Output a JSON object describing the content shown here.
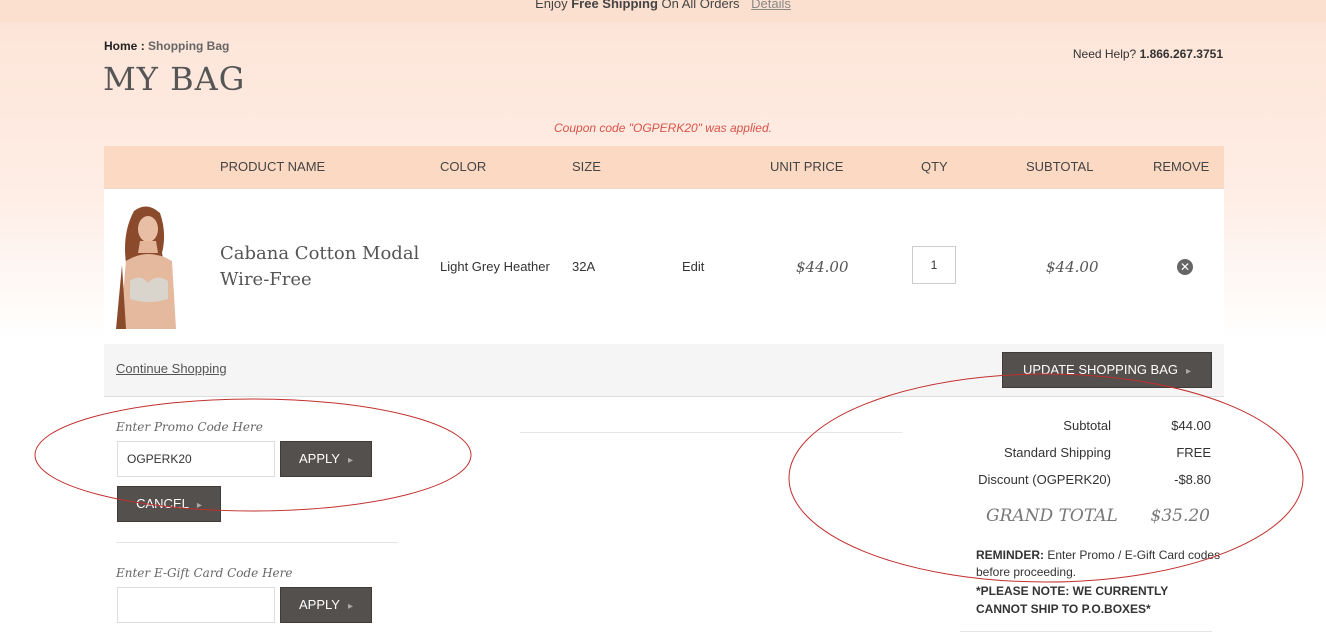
{
  "promo_banner": {
    "prefix": "Enjoy",
    "bold": "Free Shipping",
    "suffix": "On All Orders",
    "details_link": "Details"
  },
  "breadcrumb": {
    "home": "Home",
    "separator": ":",
    "current": "Shopping Bag"
  },
  "page_title": "MY BAG",
  "help": {
    "label": "Need Help?",
    "phone": "1.866.267.3751"
  },
  "coupon_message": "Coupon code \"OGPERK20\" was applied.",
  "table": {
    "headers": [
      "PRODUCT NAME",
      "COLOR",
      "SIZE",
      "UNIT PRICE",
      "QTY",
      "SUBTOTAL",
      "REMOVE"
    ],
    "items": [
      {
        "name": "Cabana Cotton Modal Wire-Free",
        "color": "Light Grey Heather",
        "size": "32A",
        "edit": "Edit",
        "unit_price": "$44.00",
        "qty": "1",
        "subtotal": "$44.00"
      }
    ]
  },
  "actions": {
    "continue": "Continue Shopping",
    "update": "UPDATE SHOPPING BAG"
  },
  "promo": {
    "label": "Enter Promo Code Here",
    "value": "OGPERK20",
    "apply": "APPLY",
    "cancel": "CANCEL"
  },
  "gift": {
    "label": "Enter E-Gift Card Code Here",
    "value": "",
    "apply": "APPLY"
  },
  "summary": {
    "subtotal_label": "Subtotal",
    "subtotal": "$44.00",
    "shipping_label": "Standard Shipping",
    "shipping": "FREE",
    "discount_label": "Discount (OGPERK20)",
    "discount": "-$8.80",
    "grand_label": "GRAND TOTAL",
    "grand": "$35.20"
  },
  "reminder": {
    "bold": "REMINDER:",
    "text": "Enter Promo / E-Gift Card codes before proceeding."
  },
  "note": "*PLEASE NOTE: WE CURRENTLY CANNOT SHIP TO P.O.BOXES*",
  "colors": {
    "banner": "#fce0cf",
    "header_row": "#fbd9c3",
    "button": "#54504d",
    "coupon": "#d9544a",
    "annotation": "#c0302e"
  },
  "icons": {
    "remove": "close-circle-icon",
    "arrow": "chevron-right-icon"
  }
}
